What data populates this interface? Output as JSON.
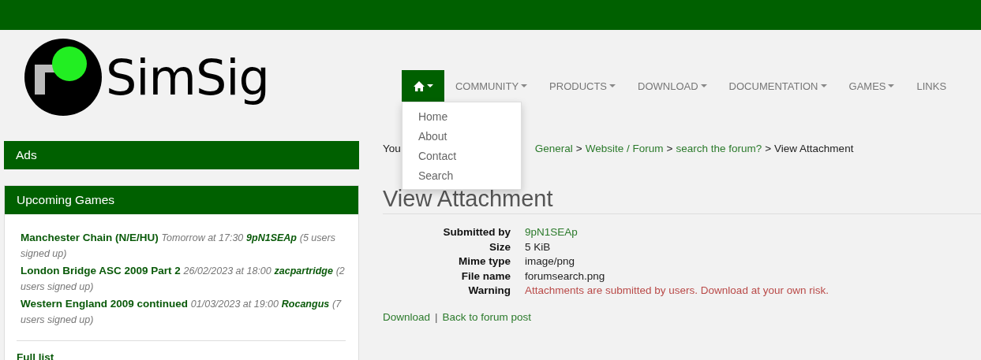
{
  "logo": {
    "text": "SimSig"
  },
  "nav": [
    {
      "kind": "home",
      "selected": true,
      "caret": true
    },
    {
      "label": "COMMUNITY",
      "kind": "text",
      "selected": false,
      "caret": true
    },
    {
      "label": "PRODUCTS",
      "kind": "text",
      "selected": false,
      "caret": true
    },
    {
      "label": "DOWNLOAD",
      "kind": "text",
      "selected": false,
      "caret": true
    },
    {
      "label": "DOCUMENTATION",
      "kind": "text",
      "selected": false,
      "caret": true
    },
    {
      "label": "GAMES",
      "kind": "text",
      "selected": false,
      "caret": true
    },
    {
      "label": "LINKS",
      "kind": "text",
      "selected": false,
      "caret": false
    }
  ],
  "dropdown": [
    "Home",
    "About",
    "Contact",
    "Search"
  ],
  "sidebar": {
    "ads_title": "Ads",
    "games_title": "Upcoming Games",
    "games": [
      {
        "title": "Manchester Chain (N/E/HU)",
        "time": "Tomorrow at 17:30",
        "host": "9pN1SEAp",
        "signups": "(5 users signed up)"
      },
      {
        "title": "London Bridge ASC 2009 Part 2",
        "time": "26/02/2023 at 18:00",
        "host": "zacpartridge",
        "signups": "(2 users signed up)"
      },
      {
        "title": "Western England 2009 continued",
        "time": "01/03/2023 at 19:00",
        "host": "Rocangus",
        "signups": "(7 users signed up)"
      }
    ],
    "full_list": "Full list"
  },
  "breadcrumb": {
    "lead": "You",
    "separator": ">",
    "links": [
      "General",
      "Website / Forum",
      "search the forum?"
    ],
    "current": "View Attachment"
  },
  "title": "View Attachment",
  "details": [
    {
      "label": "Submitted by",
      "value": "9pN1SEAp",
      "kind": "link"
    },
    {
      "label": "Size",
      "value": "5 KiB",
      "kind": "text"
    },
    {
      "label": "Mime type",
      "value": "image/png",
      "kind": "text"
    },
    {
      "label": "File name",
      "value": "forumsearch.png",
      "kind": "text"
    },
    {
      "label": "Warning",
      "value": "Attachments are submitted by users. Download at your own risk.",
      "kind": "warning"
    }
  ],
  "actions": [
    "Download",
    "Back to forum post"
  ],
  "actions_separator": "|"
}
